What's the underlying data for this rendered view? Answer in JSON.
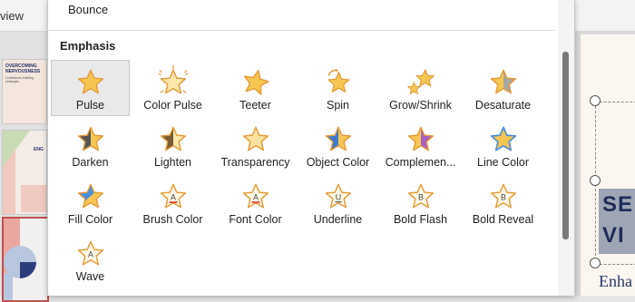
{
  "background": {
    "ribbon_tab_partial": "view",
    "slide_thumbnails": [
      {
        "title": "OVERCOMING NERVOUSNESS",
        "subtitle": "Confidence-building strategies"
      },
      {
        "title": "ENG"
      },
      {
        "title": ""
      }
    ],
    "slide_title_partial": [
      "SE",
      "VI"
    ],
    "slide_subtitle_partial": "Enha"
  },
  "gallery": {
    "previous_item_label": "Bounce",
    "section_title": "Emphasis",
    "selected": "Pulse",
    "effects": [
      {
        "label": "Pulse",
        "icon": "pulse-star-icon"
      },
      {
        "label": "Color Pulse",
        "icon": "color-pulse-star-icon"
      },
      {
        "label": "Teeter",
        "icon": "teeter-star-icon"
      },
      {
        "label": "Spin",
        "icon": "spin-star-icon"
      },
      {
        "label": "Grow/Shrink",
        "icon": "grow-shrink-star-icon"
      },
      {
        "label": "Desaturate",
        "icon": "desaturate-star-icon"
      },
      {
        "label": "Darken",
        "icon": "darken-star-icon"
      },
      {
        "label": "Lighten",
        "icon": "lighten-star-icon"
      },
      {
        "label": "Transparency",
        "icon": "transparency-star-icon"
      },
      {
        "label": "Object Color",
        "icon": "object-color-star-icon"
      },
      {
        "label": "Complemen...",
        "icon": "complementary-color-star-icon"
      },
      {
        "label": "Line Color",
        "icon": "line-color-star-icon"
      },
      {
        "label": "Fill Color",
        "icon": "fill-color-star-icon"
      },
      {
        "label": "Brush Color",
        "icon": "brush-color-star-icon"
      },
      {
        "label": "Font Color",
        "icon": "font-color-star-icon"
      },
      {
        "label": "Underline",
        "icon": "underline-star-icon"
      },
      {
        "label": "Bold Flash",
        "icon": "bold-flash-star-icon"
      },
      {
        "label": "Bold Reveal",
        "icon": "bold-reveal-star-icon"
      },
      {
        "label": "Wave",
        "icon": "wave-star-icon"
      }
    ],
    "colors": {
      "star_fill": "#f6c653",
      "star_outline": "#e39a35",
      "selected_bg": "#e9e9e9"
    }
  }
}
